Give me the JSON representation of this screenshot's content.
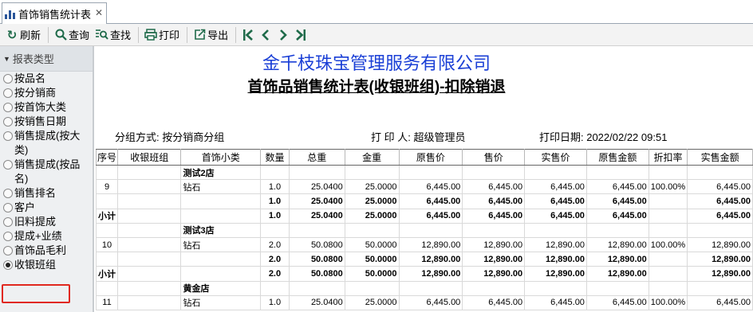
{
  "tab": {
    "label": "首饰销售统计表",
    "close": "✕"
  },
  "toolbar": {
    "refresh": "刷新",
    "query": "查询",
    "find": "查找",
    "print": "打印",
    "export": "导出"
  },
  "sidebar": {
    "header": "报表类型",
    "items": [
      {
        "label": "按品名",
        "checked": false
      },
      {
        "label": "按分销商",
        "checked": false
      },
      {
        "label": "按首饰大类",
        "checked": false
      },
      {
        "label": "按销售日期",
        "checked": false
      },
      {
        "label": "销售提成(按大类)",
        "checked": false
      },
      {
        "label": "销售提成(按品名)",
        "checked": false
      },
      {
        "label": "销售排名",
        "checked": false
      },
      {
        "label": "客户",
        "checked": false
      },
      {
        "label": "旧料提成",
        "checked": false
      },
      {
        "label": "提成+业绩",
        "checked": false
      },
      {
        "label": "首饰品毛利",
        "checked": false
      },
      {
        "label": "收银班组",
        "checked": true
      }
    ]
  },
  "report": {
    "company": "金千枝珠宝管理服务有限公司",
    "title": "首饰品销售统计表(收银班组)-扣除销退",
    "group_by": "分组方式: 按分销商分组",
    "printer": "打 印 人: 超级管理员",
    "print_date": "打印日期: 2022/02/22 09:51",
    "columns": [
      "序号",
      "收银班组",
      "首饰小类",
      "数量",
      "总重",
      "金重",
      "原售价",
      "售价",
      "实售价",
      "原售金额",
      "折扣率",
      "实售金额"
    ],
    "rows": [
      {
        "kind": "group",
        "cells": [
          "",
          "",
          "测试2店",
          "",
          "",
          "",
          "",
          "",
          "",
          "",
          "",
          ""
        ]
      },
      {
        "kind": "detail",
        "cells": [
          "9",
          "",
          "钻石",
          "1.0",
          "25.0400",
          "25.0000",
          "6,445.00",
          "6,445.00",
          "6,445.00",
          "6,445.00",
          "100.00%",
          "6,445.00"
        ]
      },
      {
        "kind": "total",
        "cells": [
          "",
          "",
          "",
          "1.0",
          "25.0400",
          "25.0000",
          "6,445.00",
          "6,445.00",
          "6,445.00",
          "6,445.00",
          "",
          "6,445.00"
        ]
      },
      {
        "kind": "subtotal",
        "cells": [
          "小计",
          "",
          "",
          "1.0",
          "25.0400",
          "25.0000",
          "6,445.00",
          "6,445.00",
          "6,445.00",
          "6,445.00",
          "",
          "6,445.00"
        ]
      },
      {
        "kind": "group",
        "cells": [
          "",
          "",
          "测试3店",
          "",
          "",
          "",
          "",
          "",
          "",
          "",
          "",
          ""
        ]
      },
      {
        "kind": "detail",
        "cells": [
          "10",
          "",
          "钻石",
          "2.0",
          "50.0800",
          "50.0000",
          "12,890.00",
          "12,890.00",
          "12,890.00",
          "12,890.00",
          "100.00%",
          "12,890.00"
        ]
      },
      {
        "kind": "total",
        "cells": [
          "",
          "",
          "",
          "2.0",
          "50.0800",
          "50.0000",
          "12,890.00",
          "12,890.00",
          "12,890.00",
          "12,890.00",
          "",
          "12,890.00"
        ]
      },
      {
        "kind": "subtotal",
        "cells": [
          "小计",
          "",
          "",
          "2.0",
          "50.0800",
          "50.0000",
          "12,890.00",
          "12,890.00",
          "12,890.00",
          "12,890.00",
          "",
          "12,890.00"
        ]
      },
      {
        "kind": "group",
        "cells": [
          "",
          "",
          "黄金店",
          "",
          "",
          "",
          "",
          "",
          "",
          "",
          "",
          ""
        ]
      },
      {
        "kind": "detail",
        "cells": [
          "11",
          "",
          "钻石",
          "1.0",
          "25.0400",
          "25.0000",
          "6,445.00",
          "6,445.00",
          "6,445.00",
          "6,445.00",
          "100.00%",
          "6,445.00"
        ]
      }
    ]
  },
  "colors": {
    "company": "#1a3fd6",
    "toolbar_icon": "#1f6b4a",
    "highlight": "#e0281e"
  }
}
